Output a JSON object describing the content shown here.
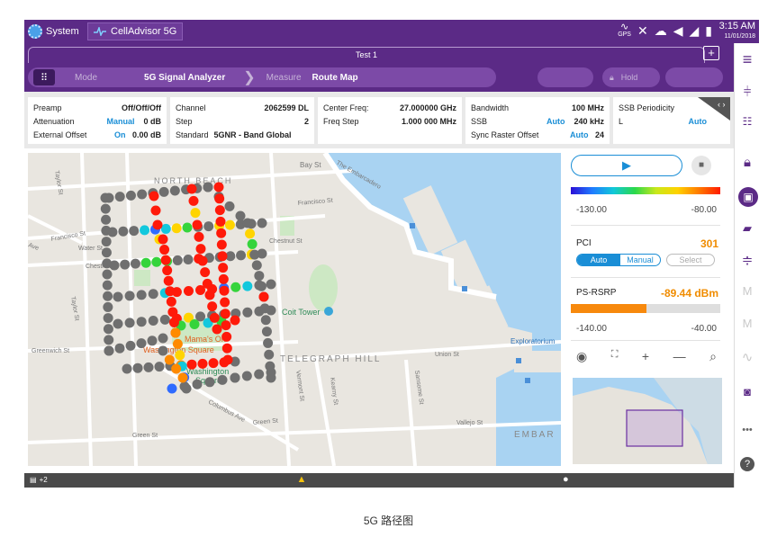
{
  "status_bar": {
    "system_label": "System",
    "app_tab_label": "CellAdvisor 5G",
    "time": "3:15 AM",
    "date": "11/01/2018",
    "gps_label": "GPS"
  },
  "test_bar": {
    "tab_label": "Test 1",
    "add_label": "+"
  },
  "mode_bar": {
    "mode_label": "Mode",
    "mode_value": "5G Signal Analyzer",
    "measure_label": "Measure",
    "measure_value": "Route Map",
    "hold_label": "Hold"
  },
  "params": {
    "col1": [
      {
        "label": "Preamp",
        "value": "Off/Off/Off",
        "blue": ""
      },
      {
        "label": "Attenuation",
        "value": "0 dB",
        "blue": "Manual"
      },
      {
        "label": "External Offset",
        "value": "0.00 dB",
        "blue": "On"
      }
    ],
    "col2": [
      {
        "label": "Channel",
        "value": "2062599 DL"
      },
      {
        "label": "Step",
        "value": "2"
      },
      {
        "label": "Standard",
        "value": "5GNR - Band Global"
      }
    ],
    "col3": [
      {
        "label": "Center Freq:",
        "value": "27.000000 GHz"
      },
      {
        "label": "Freq Step",
        "value": "1.000 000 MHz"
      }
    ],
    "col4": [
      {
        "label": "Bandwidth",
        "value": "100 MHz",
        "blue": ""
      },
      {
        "label": "SSB",
        "value": "240 kHz",
        "blue": "Auto"
      },
      {
        "label": "Sync Raster Offset",
        "value": "24",
        "blue": "Auto"
      }
    ],
    "col5": [
      {
        "label": "SSB Periodicity",
        "value": ""
      },
      {
        "label": "L",
        "value": "Auto"
      }
    ]
  },
  "map": {
    "labels": {
      "bay_st": "Bay St",
      "embarcadero": "The Embarcadero",
      "north_beach": "NORTH BEACH",
      "francisco_st_left": "Francisco St",
      "francisco_st_right": "Francisco St",
      "water_st": "Water St",
      "chestnut_st": "Chestnut St",
      "chestnut_st_left": "Chestnut",
      "taylor_st": "Taylor St",
      "taylor_st_top": "Taylor St",
      "coit_tower": "Coit Tower",
      "mamas": "Mama's On",
      "washington_sq": "Washington Square",
      "washington_sq_green_1": "Washington",
      "washington_sq_green_2": "Square",
      "telegraph_hill": "TELEGRAPH HILL",
      "union_st": "Union St",
      "green_st_left": "Green St",
      "green_st_mid": "Green St",
      "greenwich_st": "Greenwich St",
      "columbus_ave": "Columbus Ave",
      "vallejo_st": "Vallejo St",
      "exploratorium": "Exploratorium",
      "embar": "EMBAR",
      "sansome_st": "Sansome St",
      "kearny_st": "Kearny St",
      "vermont_st": "Vermont St",
      "ave": "Ave"
    },
    "point_colors": {
      "gray": "#6f6f6f",
      "red": "#ff1a0a",
      "orange": "#ff8a00",
      "yellow": "#ffd400",
      "green": "#35d43c",
      "cyan": "#12c8dd",
      "blue": "#2f6bff"
    }
  },
  "panel": {
    "scale_min": "-130.00",
    "scale_max": "-80.00",
    "pci_label": "PCI",
    "pci_value": "301",
    "auto_label": "Auto",
    "manual_label": "Manual",
    "select_label": "Select",
    "rsrp_label": "PS-RSRP",
    "rsrp_value": "-89.44 dBm",
    "rsrp_fraction": 0.506,
    "rsrp_min": "-140.00",
    "rsrp_max": "-40.00"
  },
  "bottom_bar": {
    "count_label": "+2"
  },
  "caption": "5G 路径图"
}
